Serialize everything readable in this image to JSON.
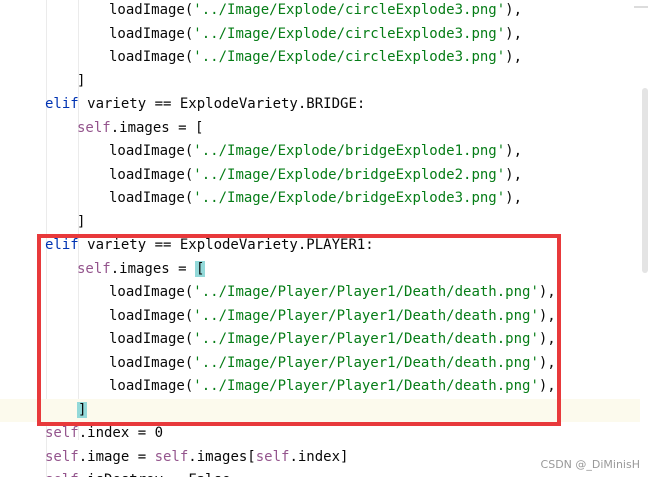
{
  "code_lines": [
    {
      "parts": [
        {
          "t": "loadImage(",
          "c": ""
        },
        {
          "t": "'../Image/Explode/circleExplode3.png'",
          "c": "str"
        },
        {
          "t": "),",
          "c": ""
        }
      ]
    },
    {
      "parts": [
        {
          "t": "loadImage(",
          "c": ""
        },
        {
          "t": "'../Image/Explode/circleExplode3.png'",
          "c": "str"
        },
        {
          "t": "),",
          "c": ""
        }
      ]
    },
    {
      "parts": [
        {
          "t": "loadImage(",
          "c": ""
        },
        {
          "t": "'../Image/Explode/circleExplode3.png'",
          "c": "str"
        },
        {
          "t": "),",
          "c": ""
        }
      ]
    },
    {
      "parts": [
        {
          "t": "]",
          "c": ""
        }
      ]
    },
    {
      "parts": [
        {
          "t": "elif",
          "c": "kw"
        },
        {
          "t": " variety == ExplodeVariety.BRIDGE:",
          "c": ""
        }
      ]
    },
    {
      "parts": [
        {
          "t": "self",
          "c": "self"
        },
        {
          "t": ".images = [",
          "c": ""
        }
      ]
    },
    {
      "parts": [
        {
          "t": "loadImage(",
          "c": ""
        },
        {
          "t": "'../Image/Explode/bridgeExplode1.png'",
          "c": "str"
        },
        {
          "t": "),",
          "c": ""
        }
      ]
    },
    {
      "parts": [
        {
          "t": "loadImage(",
          "c": ""
        },
        {
          "t": "'../Image/Explode/bridgeExplode2.png'",
          "c": "str"
        },
        {
          "t": "),",
          "c": ""
        }
      ]
    },
    {
      "parts": [
        {
          "t": "loadImage(",
          "c": ""
        },
        {
          "t": "'../Image/Explode/bridgeExplode3.png'",
          "c": "str"
        },
        {
          "t": "),",
          "c": ""
        }
      ]
    },
    {
      "parts": [
        {
          "t": "]",
          "c": ""
        }
      ]
    },
    {
      "parts": [
        {
          "t": "elif",
          "c": "kw"
        },
        {
          "t": " variety == ExplodeVariety.PLAYER1:",
          "c": ""
        }
      ]
    },
    {
      "parts": [
        {
          "t": "self",
          "c": "self"
        },
        {
          "t": ".images = ",
          "c": ""
        },
        {
          "t": "[",
          "c": "bracket-hl"
        }
      ]
    },
    {
      "parts": [
        {
          "t": "loadImage(",
          "c": ""
        },
        {
          "t": "'../Image/Player/Player1/Death/death.png'",
          "c": "str"
        },
        {
          "t": "),",
          "c": ""
        }
      ]
    },
    {
      "parts": [
        {
          "t": "loadImage(",
          "c": ""
        },
        {
          "t": "'../Image/Player/Player1/Death/death.png'",
          "c": "str"
        },
        {
          "t": "),",
          "c": ""
        }
      ]
    },
    {
      "parts": [
        {
          "t": "loadImage(",
          "c": ""
        },
        {
          "t": "'../Image/Player/Player1/Death/death.png'",
          "c": "str"
        },
        {
          "t": "),",
          "c": ""
        }
      ]
    },
    {
      "parts": [
        {
          "t": "loadImage(",
          "c": ""
        },
        {
          "t": "'../Image/Player/Player1/Death/death.png'",
          "c": "str"
        },
        {
          "t": "),",
          "c": ""
        }
      ]
    },
    {
      "parts": [
        {
          "t": "loadImage(",
          "c": ""
        },
        {
          "t": "'../Image/Player/Player1/Death/death.png'",
          "c": "str"
        },
        {
          "t": "),",
          "c": ""
        }
      ]
    },
    {
      "parts": [
        {
          "t": "]",
          "c": "bracket-hl"
        }
      ]
    },
    {
      "parts": [
        {
          "t": "self",
          "c": "self"
        },
        {
          "t": ".index = 0",
          "c": ""
        }
      ]
    },
    {
      "parts": [
        {
          "t": "self",
          "c": "self"
        },
        {
          "t": ".image = ",
          "c": ""
        },
        {
          "t": "self",
          "c": "self"
        },
        {
          "t": ".images[",
          "c": ""
        },
        {
          "t": "self",
          "c": "self"
        },
        {
          "t": ".index]",
          "c": ""
        }
      ]
    },
    {
      "parts": [
        {
          "t": "self",
          "c": "self"
        },
        {
          "t": ".isDestroy = False",
          "c": ""
        }
      ]
    }
  ],
  "watermark": "CSDN @_DiMinisH",
  "colors": {
    "keyword": "#0033b3",
    "self": "#94558d",
    "string": "#067d17",
    "highlight_box": "#e8393b",
    "current_line": "#fcfaed"
  }
}
